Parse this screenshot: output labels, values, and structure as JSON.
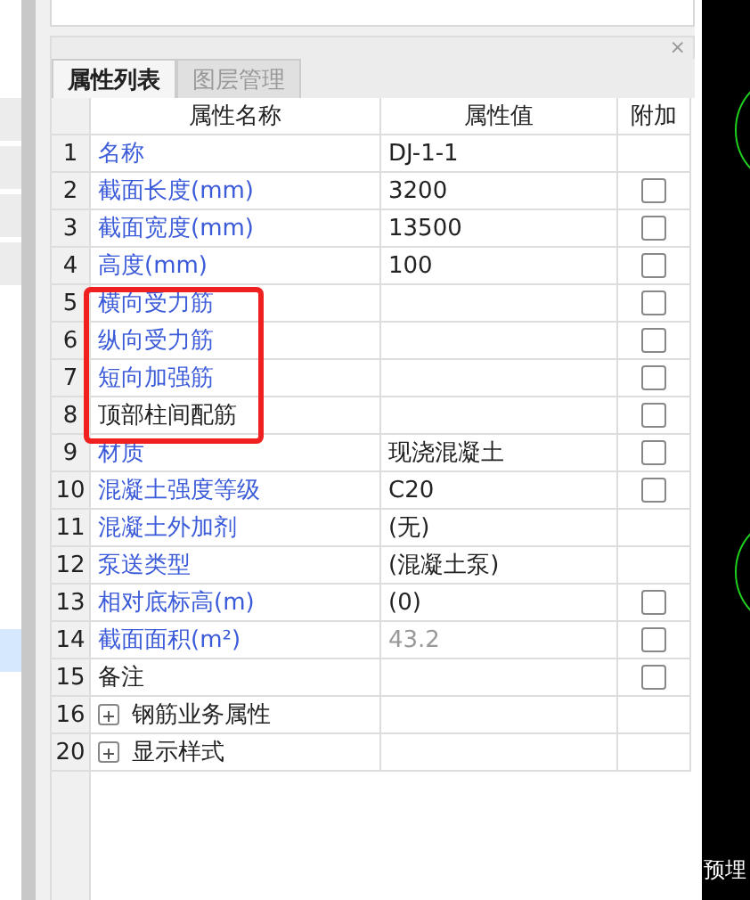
{
  "panel": {
    "close": "×"
  },
  "tabs": [
    {
      "label": "属性列表",
      "selected": true
    },
    {
      "label": "图层管理",
      "selected": false
    }
  ],
  "table": {
    "columns": [
      "属性名称",
      "属性值",
      "附加"
    ],
    "rows": [
      {
        "kind": "property",
        "index": "1",
        "name": "名称",
        "linked": true,
        "value": "DJ-1-1",
        "dimmed": false
      },
      {
        "kind": "property",
        "index": "2",
        "name": "截面长度(mm)",
        "linked": true,
        "value": "3200",
        "dimmed": false,
        "checked": false
      },
      {
        "kind": "property",
        "index": "3",
        "name": "截面宽度(mm)",
        "linked": true,
        "value": "13500",
        "dimmed": false,
        "checked": false
      },
      {
        "kind": "property",
        "index": "4",
        "name": "高度(mm)",
        "linked": true,
        "value": "100",
        "dimmed": false,
        "checked": false
      },
      {
        "kind": "property",
        "index": "5",
        "name": "横向受力筋",
        "linked": true,
        "checked": false
      },
      {
        "kind": "property",
        "index": "6",
        "name": "纵向受力筋",
        "linked": true,
        "checked": false
      },
      {
        "kind": "property",
        "index": "7",
        "name": "短向加强筋",
        "linked": true,
        "checked": false
      },
      {
        "kind": "property",
        "index": "8",
        "name": "顶部柱间配筋",
        "linked": false,
        "checked": false
      },
      {
        "kind": "property",
        "index": "9",
        "name": "材质",
        "linked": true,
        "value": "现浇混凝土",
        "dimmed": false,
        "checked": false
      },
      {
        "kind": "property",
        "index": "10",
        "name": "混凝土强度等级",
        "linked": true,
        "value": "C20",
        "dimmed": false,
        "checked": false
      },
      {
        "kind": "property",
        "index": "11",
        "name": "混凝土外加剂",
        "linked": true,
        "value": "(无)",
        "dimmed": false
      },
      {
        "kind": "property",
        "index": "12",
        "name": "泵送类型",
        "linked": true,
        "value": "(混凝土泵)",
        "dimmed": false
      },
      {
        "kind": "property",
        "index": "13",
        "name": "相对底标高(m)",
        "linked": true,
        "value": "(0)",
        "dimmed": false,
        "checked": false
      },
      {
        "kind": "property",
        "index": "14",
        "name": "截面面积(m²)",
        "linked": true,
        "value": "43.2",
        "dimmed": true,
        "checked": false
      },
      {
        "kind": "property",
        "index": "15",
        "name": "备注",
        "linked": false,
        "checked": false
      },
      {
        "kind": "group",
        "index": "16",
        "name": "钢筋业务属性",
        "expanded": false
      },
      {
        "kind": "group",
        "index": "20",
        "name": "显示样式",
        "expanded": false
      }
    ]
  },
  "canvas": {
    "label": "预埋"
  }
}
